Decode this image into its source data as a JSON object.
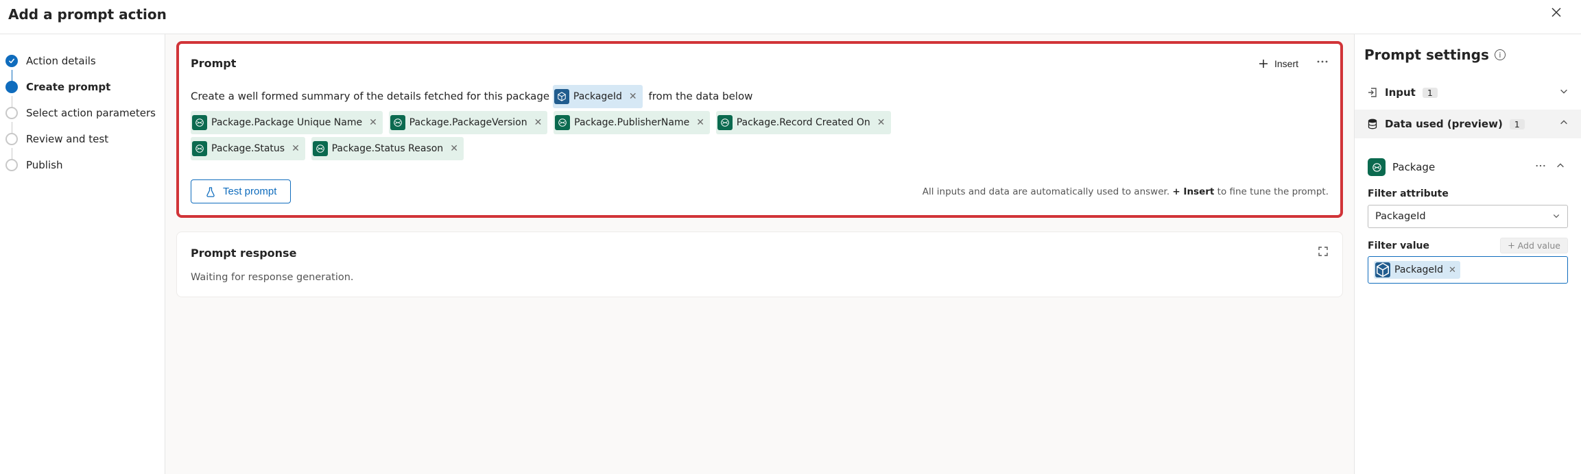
{
  "header": {
    "title": "Add a prompt action"
  },
  "wizard": {
    "steps": [
      {
        "label": "Action details",
        "state": "done"
      },
      {
        "label": "Create prompt",
        "state": "active"
      },
      {
        "label": "Select action parameters",
        "state": "future"
      },
      {
        "label": "Review and test",
        "state": "future"
      },
      {
        "label": "Publish",
        "state": "future"
      }
    ]
  },
  "prompt_card": {
    "title": "Prompt",
    "insert_label": "Insert",
    "text_before": "Create a well formed summary of the details fetched for this package",
    "text_after": "from the data below",
    "inline_token": {
      "label": "PackageId",
      "kind": "blue"
    },
    "tokens": [
      {
        "label": "Package.Package Unique Name",
        "kind": "green"
      },
      {
        "label": "Package.PackageVersion",
        "kind": "green"
      },
      {
        "label": "Package.PublisherName",
        "kind": "green"
      },
      {
        "label": "Package.Record Created On",
        "kind": "green"
      },
      {
        "label": "Package.Status",
        "kind": "green"
      },
      {
        "label": "Package.Status Reason",
        "kind": "green"
      }
    ],
    "test_label": "Test prompt",
    "helper_prefix": "All inputs and data are automatically used to answer. ",
    "helper_bold": "+ Insert",
    "helper_suffix": " to fine tune the prompt."
  },
  "response_card": {
    "title": "Prompt response",
    "message": "Waiting for response generation."
  },
  "settings": {
    "title": "Prompt settings",
    "input_label": "Input",
    "input_count": "1",
    "data_used_label": "Data used (preview)",
    "data_used_count": "1",
    "entity_name": "Package",
    "filter_attribute_label": "Filter attribute",
    "filter_attribute_value": "PackageId",
    "filter_value_label": "Filter value",
    "add_value_label": "Add value",
    "filter_value_chip": "PackageId"
  }
}
